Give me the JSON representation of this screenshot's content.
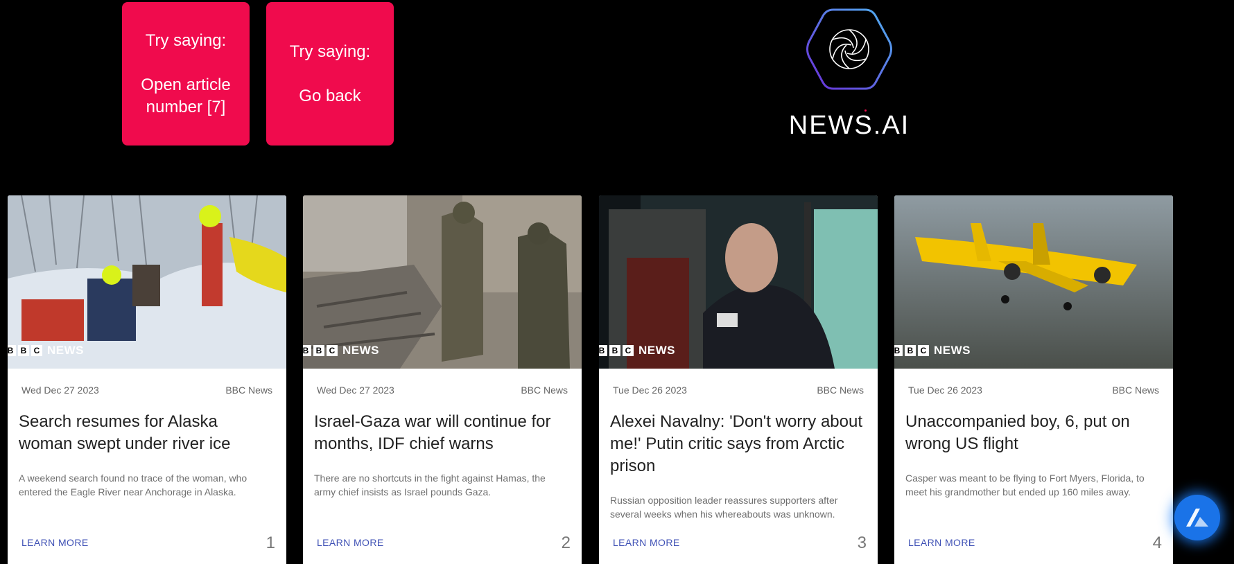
{
  "hints": [
    {
      "label": "Try saying:",
      "command": "Open article number [7]"
    },
    {
      "label": "Try saying:",
      "command": "Go back"
    }
  ],
  "logo": {
    "text": "NEWS.AI"
  },
  "articles": [
    {
      "date": "Wed Dec 27 2023",
      "source": "BBC News",
      "title": "Search resumes for Alaska woman swept under river ice",
      "description": "A weekend search found no trace of the woman, who entered the Eagle River near Anchorage in Alaska.",
      "learn_more": "LEARN MORE",
      "number": "1",
      "badge": "NEWS"
    },
    {
      "date": "Wed Dec 27 2023",
      "source": "BBC News",
      "title": "Israel-Gaza war will continue for months, IDF chief warns",
      "description": "There are no shortcuts in the fight against Hamas, the army chief insists as Israel pounds Gaza.",
      "learn_more": "LEARN MORE",
      "number": "2",
      "badge": "NEWS"
    },
    {
      "date": "Tue Dec 26 2023",
      "source": "BBC News",
      "title": "Alexei Navalny: 'Don't worry about me!' Putin critic says from Arctic prison",
      "description": "Russian opposition leader reassures supporters after several weeks when his whereabouts was unknown.",
      "learn_more": "LEARN MORE",
      "number": "3",
      "badge": "NEWS"
    },
    {
      "date": "Tue Dec 26 2023",
      "source": "BBC News",
      "title": "Unaccompanied boy, 6, put on wrong US flight",
      "description": "Casper was meant to be flying to Fort Myers, Florida, to meet his grandmother but ended up 160 miles away.",
      "learn_more": "LEARN MORE",
      "number": "4",
      "badge": "NEWS"
    }
  ],
  "colors": {
    "hint_bg": "#f00b4d",
    "link": "#3f51b5",
    "fab": "#1a73e8"
  },
  "icons": {
    "logo": "aperture-hexagon-icon",
    "fab": "alan-assistant-icon"
  }
}
